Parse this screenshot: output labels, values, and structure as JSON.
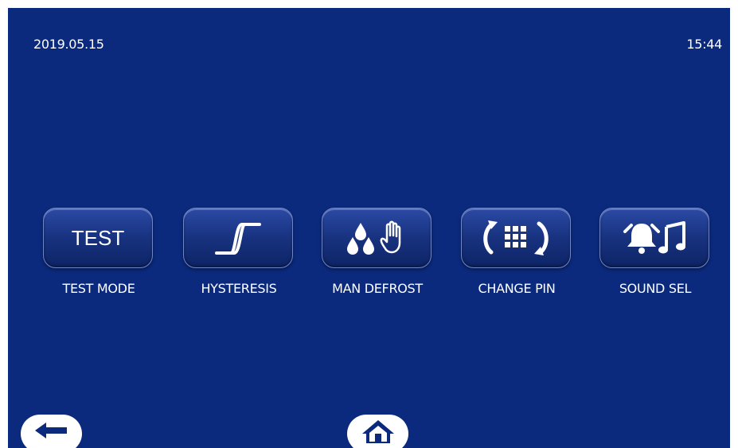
{
  "header": {
    "date": "2019.05.15",
    "time": "15:44"
  },
  "tiles": [
    {
      "id": "test-mode",
      "button_text": "TEST",
      "label": "TEST MODE",
      "icon": "text"
    },
    {
      "id": "hysteresis",
      "label": "HYSTERESIS",
      "icon": "hysteresis-curve-icon"
    },
    {
      "id": "man-defrost",
      "label": "MAN DEFROST",
      "icon": "droplets-hand-icon"
    },
    {
      "id": "change-pin",
      "label": "CHANGE PIN",
      "icon": "keypad-refresh-icon"
    },
    {
      "id": "sound-sel",
      "label": "SOUND SEL",
      "icon": "bell-music-icon"
    }
  ],
  "footer": {
    "back_icon": "back-arrow-icon",
    "home_icon": "home-icon"
  },
  "colors": {
    "background": "#0b2a7e",
    "tile_gradient_top": "#2b4aa5",
    "tile_gradient_bottom": "#0d2466",
    "text": "#ffffff"
  }
}
